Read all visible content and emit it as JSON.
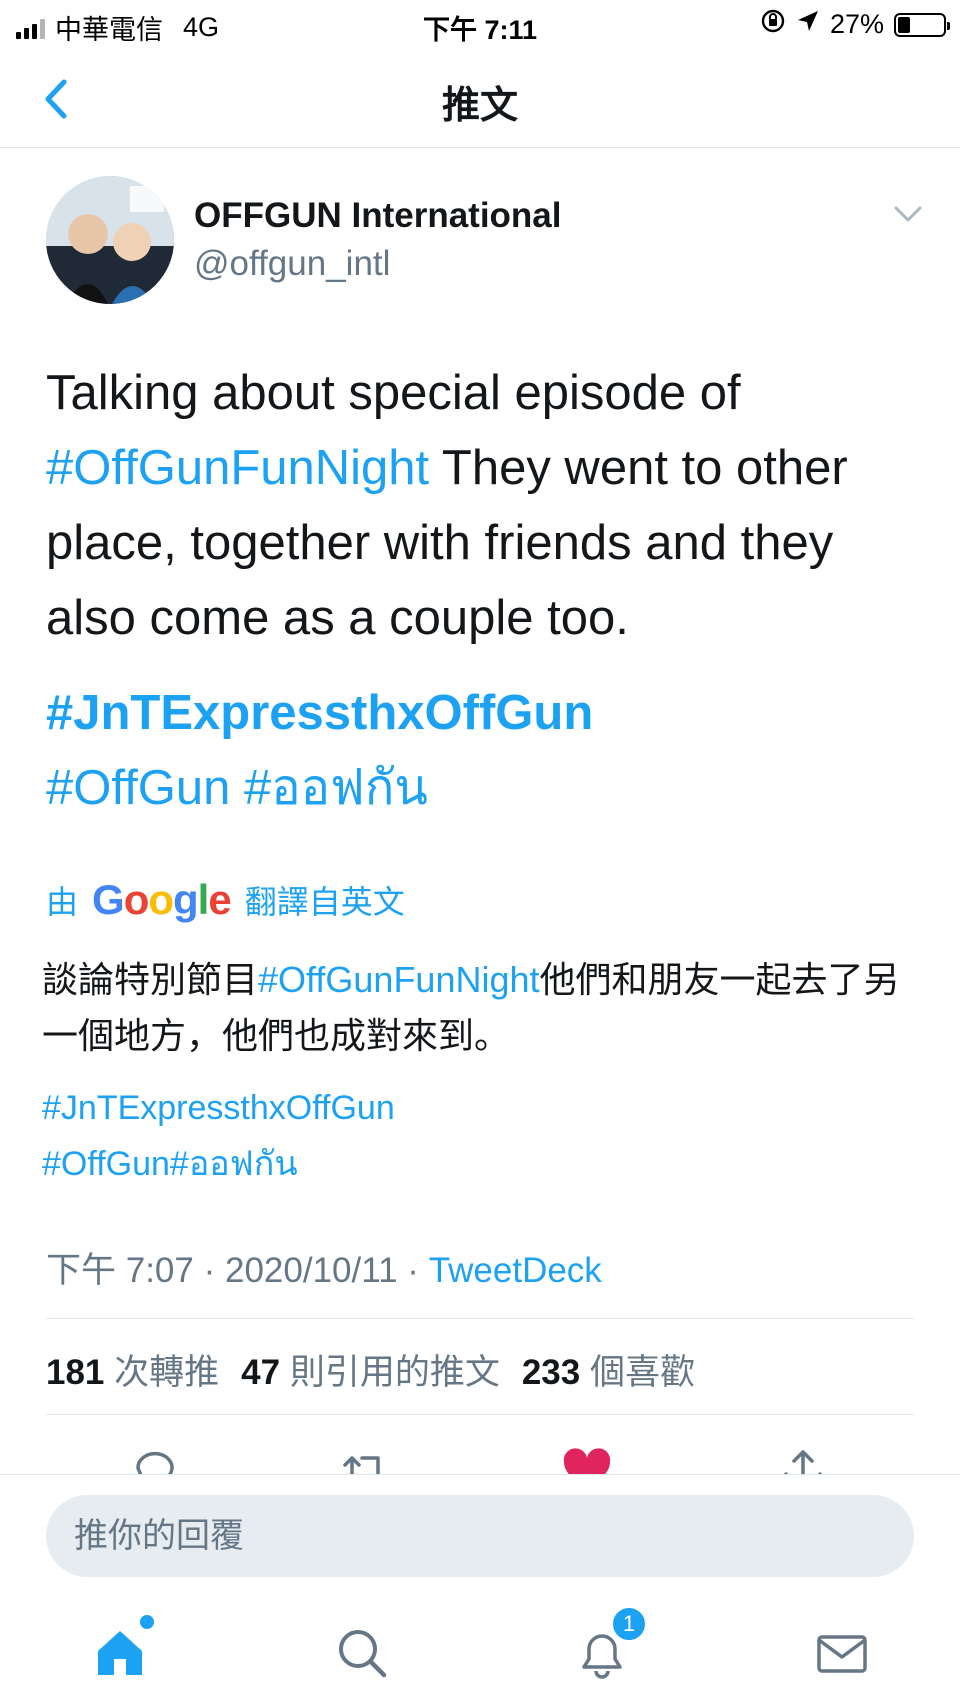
{
  "status_bar": {
    "carrier": "中華電信",
    "network": "4G",
    "time": "下午 7:11",
    "battery_percent": "27%",
    "battery_level": 0.27
  },
  "header": {
    "title": "推文"
  },
  "author": {
    "display_name": "OFFGUN International",
    "handle": "@offgun_intl"
  },
  "tweet": {
    "text_part1": "Talking about special episode of ",
    "hashtag1": "#OffGunFunNight",
    "text_part2": " They went to other place, together with friends and they also come as a couple too.",
    "hashtag2": "#JnTExpressthxOffGun",
    "hashtag3": "#OffGun",
    "hashtag4": "#ออฟกัน"
  },
  "translation": {
    "prefix": "由",
    "google": "Google",
    "suffix": "翻譯自英文",
    "text_part1": "談論特別節目",
    "hashtag1": "#OffGunFunNight",
    "text_part2": "他們和朋友一起去了另一個地方，他們也成對來到。",
    "hashtag2": "#JnTExpressthxOffGun",
    "hashtag3": "#OffGun",
    "hashtag4": "#ออฟกัน"
  },
  "meta": {
    "time": "下午 7:07",
    "separator": "·",
    "date": "2020/10/11",
    "source": "TweetDeck"
  },
  "stats": {
    "retweets_count": "181",
    "retweets_label": "次轉推",
    "quotes_count": "47",
    "quotes_label": "則引用的推文",
    "likes_count": "233",
    "likes_label": "個喜歡"
  },
  "reply": {
    "placeholder": "推你的回覆"
  },
  "tabbar": {
    "notification_badge": "1"
  },
  "colors": {
    "accent": "#1da1f2",
    "text": "#14171a",
    "secondary": "#657786",
    "like": "#e0245e",
    "divider": "#e1e8ed",
    "input_bg": "#e6ecf0"
  }
}
